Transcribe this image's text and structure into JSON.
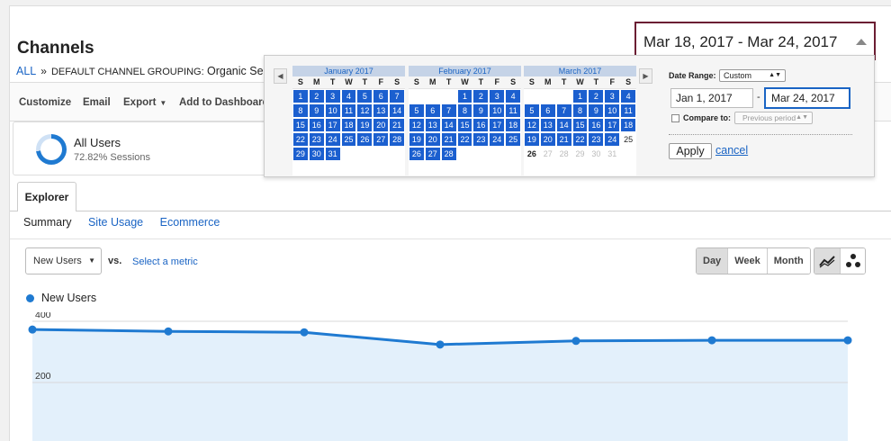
{
  "header": {
    "title": "Channels",
    "breadcrumb": {
      "all": "ALL",
      "separator": "»",
      "grouping": "DEFAULT CHANNEL GROUPING:",
      "value": "Organic Search"
    }
  },
  "toolbar": {
    "customize": "Customize",
    "email": "Email",
    "export": "Export",
    "add_dashboard": "Add to Dashboard"
  },
  "segment": {
    "name": "All Users",
    "subtitle": "72.82% Sessions",
    "share_percent": 72.82
  },
  "tabs": {
    "explorer": "Explorer",
    "subtabs": [
      "Summary",
      "Site Usage",
      "Ecommerce"
    ]
  },
  "metric": {
    "selected": "New Users",
    "vs": "vs.",
    "select_metric": "Select a metric"
  },
  "period_buttons": [
    "Day",
    "Week",
    "Month"
  ],
  "date_range": {
    "display": "Mar 18, 2017 - Mar 24, 2017",
    "range_label": "Date Range:",
    "range_option": "Custom",
    "start": "Jan 1, 2017",
    "dash": "-",
    "end": "Mar 24, 2017",
    "compare_label": "Compare to:",
    "compare_option": "Previous period",
    "apply": "Apply",
    "cancel": "cancel"
  },
  "calendar": {
    "dow": [
      "S",
      "M",
      "T",
      "W",
      "T",
      "F",
      "S"
    ],
    "months": [
      {
        "name": "January 2017",
        "offset": 0,
        "days": 31,
        "selected_through": 31,
        "today": null
      },
      {
        "name": "February 2017",
        "offset": 3,
        "days": 28,
        "selected_through": 28,
        "today": null
      },
      {
        "name": "March 2017",
        "offset": 3,
        "days": 31,
        "selected_through": 24,
        "today": 26
      }
    ]
  },
  "chart_data": {
    "type": "area",
    "series": [
      {
        "name": "New Users",
        "values": [
          373,
          367,
          364,
          324,
          336,
          338,
          338
        ]
      }
    ],
    "ylim": [
      0,
      400
    ],
    "yticks": [
      200,
      400
    ],
    "color": "#1f7ad1"
  },
  "colors": {
    "accent": "#1f7ad1",
    "calendar_selected": "#1b5fcf",
    "highlight_border": "#6b1e33",
    "link": "#1a64c4"
  }
}
